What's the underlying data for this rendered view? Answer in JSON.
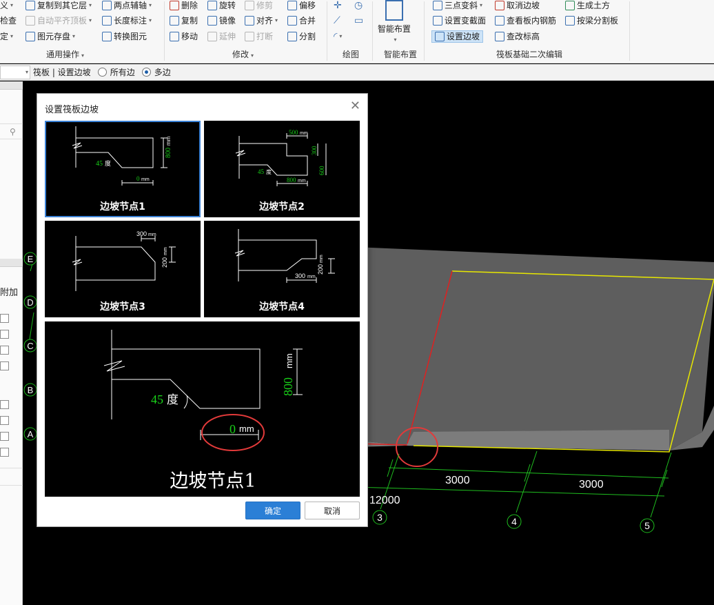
{
  "ribbon": {
    "common": {
      "group_label": "通用操作",
      "copy_to_layer": "复制到其它层",
      "auto_align_top": "自动平齐顶板",
      "save_element": "图元存盘",
      "edge_text1": "义",
      "edge_text2": "检查",
      "edge_text3": "定",
      "two_point_axis": "两点辅轴",
      "length_dimension": "长度标注",
      "convert_element": "转换图元"
    },
    "modify": {
      "group_label": "修改",
      "delete": "删除",
      "rotate": "旋转",
      "trim": "修剪",
      "offset": "偏移",
      "copy": "复制",
      "mirror": "镜像",
      "align": "对齐",
      "merge": "合并",
      "move": "移动",
      "extend": "延伸",
      "break": "打断",
      "split": "分割"
    },
    "draw": {
      "group_label": "绘图"
    },
    "smart": {
      "group_label": "智能布置",
      "button": "智能布置"
    },
    "raft": {
      "group_label": "筏板基础二次编辑",
      "three_point_slope": "三点变斜",
      "set_section_change": "设置变截面",
      "set_edge_slope": "设置边坡",
      "cancel_edge_slope": "取消边坡",
      "view_inner_rebar": "查看板内钢筋",
      "view_elevation": "查改标高",
      "generate_earthwork": "生成土方",
      "split_by_beam": "按梁分割板"
    }
  },
  "toolbar": {
    "breadcrumb": "筏板 | 设置边坡",
    "option_all": "所有边",
    "option_multi": "多边"
  },
  "left_panel": {
    "label_add": "附加"
  },
  "canvas": {
    "axis_letters": [
      "E",
      "D",
      "C",
      "B",
      "A"
    ],
    "axis_numbers": [
      "3",
      "4",
      "5"
    ],
    "dim_3000_a": "3000",
    "dim_3000_b": "3000",
    "dim_12000": "12000",
    "colors": {
      "slab_top": "#5f5f5f",
      "slab_side": "#7a7a7a",
      "yellow_edge": "#e8e800",
      "red_edge": "#e02020",
      "axis": "#1fbf1f"
    }
  },
  "dialog": {
    "title": "设置筏板边坡",
    "ok": "确定",
    "cancel": "取消",
    "options": [
      {
        "label": "边坡节点1",
        "angle": "45",
        "angle_unit": "度",
        "height": "800",
        "width": "0",
        "unit": "mm"
      },
      {
        "label": "边坡节点2",
        "angle": "45",
        "angle_unit": "度",
        "top_width": "500",
        "step_height": "300",
        "total_height": "600",
        "width": "800",
        "unit": "mm"
      },
      {
        "label": "边坡节点3",
        "width": "300",
        "height": "200",
        "unit": "mm"
      },
      {
        "label": "边坡节点4",
        "width": "300",
        "height": "200",
        "unit": "mm"
      }
    ],
    "preview": {
      "label": "边坡节点1",
      "angle": "45",
      "angle_unit": "度",
      "height": "800",
      "width": "0",
      "unit": "mm"
    },
    "colors": {
      "accent": "#2b7fd6",
      "value_green": "#19d119",
      "highlight_red": "#e23a3a"
    }
  }
}
